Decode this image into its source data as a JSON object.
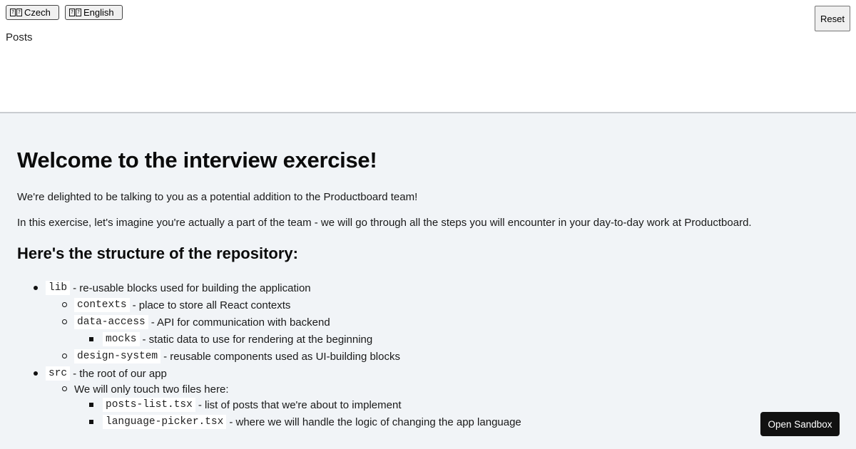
{
  "preview": {
    "languages": [
      {
        "label": "Czech",
        "flag_glyphs": [
          "?",
          "?"
        ]
      },
      {
        "label": "English",
        "flag_glyphs": [
          "?",
          "?"
        ]
      }
    ],
    "reset_label": "Reset",
    "posts_heading": "Posts"
  },
  "readme": {
    "title": "Welcome to the interview exercise!",
    "intro": "We're delighted to be talking to you as a potential addition to the Productboard team!",
    "intro2": "In this exercise, let's imagine you're actually a part of the team - we will go through all the steps you will encounter in your day-to-day work at Productboard.",
    "structure_heading": "Here's the structure of the repository:",
    "tree": {
      "lib": {
        "code": "lib",
        "text": "- re-usable blocks used for building the application"
      },
      "contexts": {
        "code": "contexts",
        "text": "- place to store all React contexts"
      },
      "data_access": {
        "code": "data-access",
        "text": "- API for communication with backend"
      },
      "mocks": {
        "code": "mocks",
        "text": "- static data to use for rendering at the beginning"
      },
      "design_system": {
        "code": "design-system",
        "text": "- reusable components used as UI-building blocks"
      },
      "src": {
        "code": "src",
        "text": "- the root of our app"
      },
      "two_files": {
        "text": "We will only touch two files here:"
      },
      "posts_list": {
        "code": "posts-list.tsx",
        "text": "- list of posts that we're about to implement"
      },
      "language_picker": {
        "code": "language-picker.tsx",
        "text": "- where we will handle the logic of changing the app language"
      }
    }
  },
  "sandbox_label": "Open Sandbox"
}
